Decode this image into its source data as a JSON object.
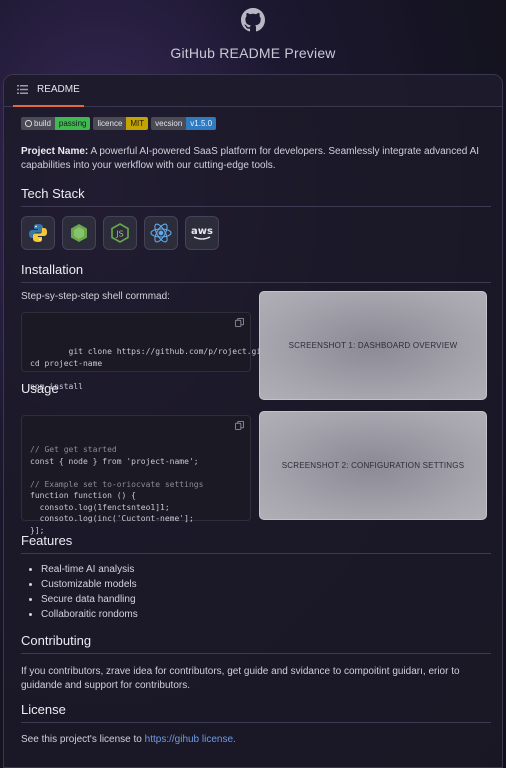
{
  "page_title": "GitHub README Preview",
  "tab": {
    "label": "README"
  },
  "badges": [
    {
      "label": "build",
      "value": "passing",
      "color": "#3fb950"
    },
    {
      "label": "licence",
      "value": "MIT",
      "color": "#c3a400"
    },
    {
      "label": "vecsion",
      "value": "v1.5.0",
      "color": "#2f7bc0"
    }
  ],
  "intro": {
    "label": "Project Name:",
    "text": " A powerful AI-powered SaaS platform for developers. Seamlessly integrate advanced AI capabilities into your werkflow with our cutting-edge tools."
  },
  "tech_stack": {
    "heading": "Tech Stack",
    "icons": [
      "python-icon",
      "nodejs-icon",
      "node-package-icon",
      "react-icon",
      "aws-icon"
    ],
    "aws_text": "aws"
  },
  "installation": {
    "heading": "Installation",
    "lead": "Step-sy-step-step shell cormmad:",
    "code": "git clone https://github.com/p/roject.git\ncd project-name\n\nnpm install"
  },
  "usage": {
    "heading": "Usage",
    "code_lines": [
      {
        "text": "// Get get started",
        "comment": true
      },
      {
        "text": "const { node } from 'project-name';",
        "comment": false
      },
      {
        "text": "",
        "comment": false
      },
      {
        "text": "// Example set to-oriocvate settings",
        "comment": true
      },
      {
        "text": "function function () {",
        "comment": false
      },
      {
        "text": "  consoto.log(1fenctsnteo1]1;",
        "comment": false
      },
      {
        "text": "  consoto.log(inc('Cuctont-neme'];",
        "comment": false
      },
      {
        "text": "}];",
        "comment": false
      }
    ]
  },
  "screenshots": [
    {
      "caption": "SCREENSHOT 1: DASHBOARD OVERVIEW"
    },
    {
      "caption": "SCREENSHOT 2: CONFIGURATION SETTINGS"
    }
  ],
  "features": {
    "heading": "Features",
    "items": [
      "Real-time AI analysis",
      "Customizable models",
      "Secure data handling",
      "Collaboraitic rondoms"
    ]
  },
  "contributing": {
    "heading": "Contributing",
    "text": "If you contributors, zrave idea for contributors, get guide and svidance to compoitint guidarı, erior to guidande and support for contributors."
  },
  "license": {
    "heading": "License",
    "text": "See this project's license to ",
    "link": "https://gihub license."
  },
  "colors": {
    "accent": "#e06a3a",
    "link": "#6f9ae6",
    "background": "#14131f"
  }
}
